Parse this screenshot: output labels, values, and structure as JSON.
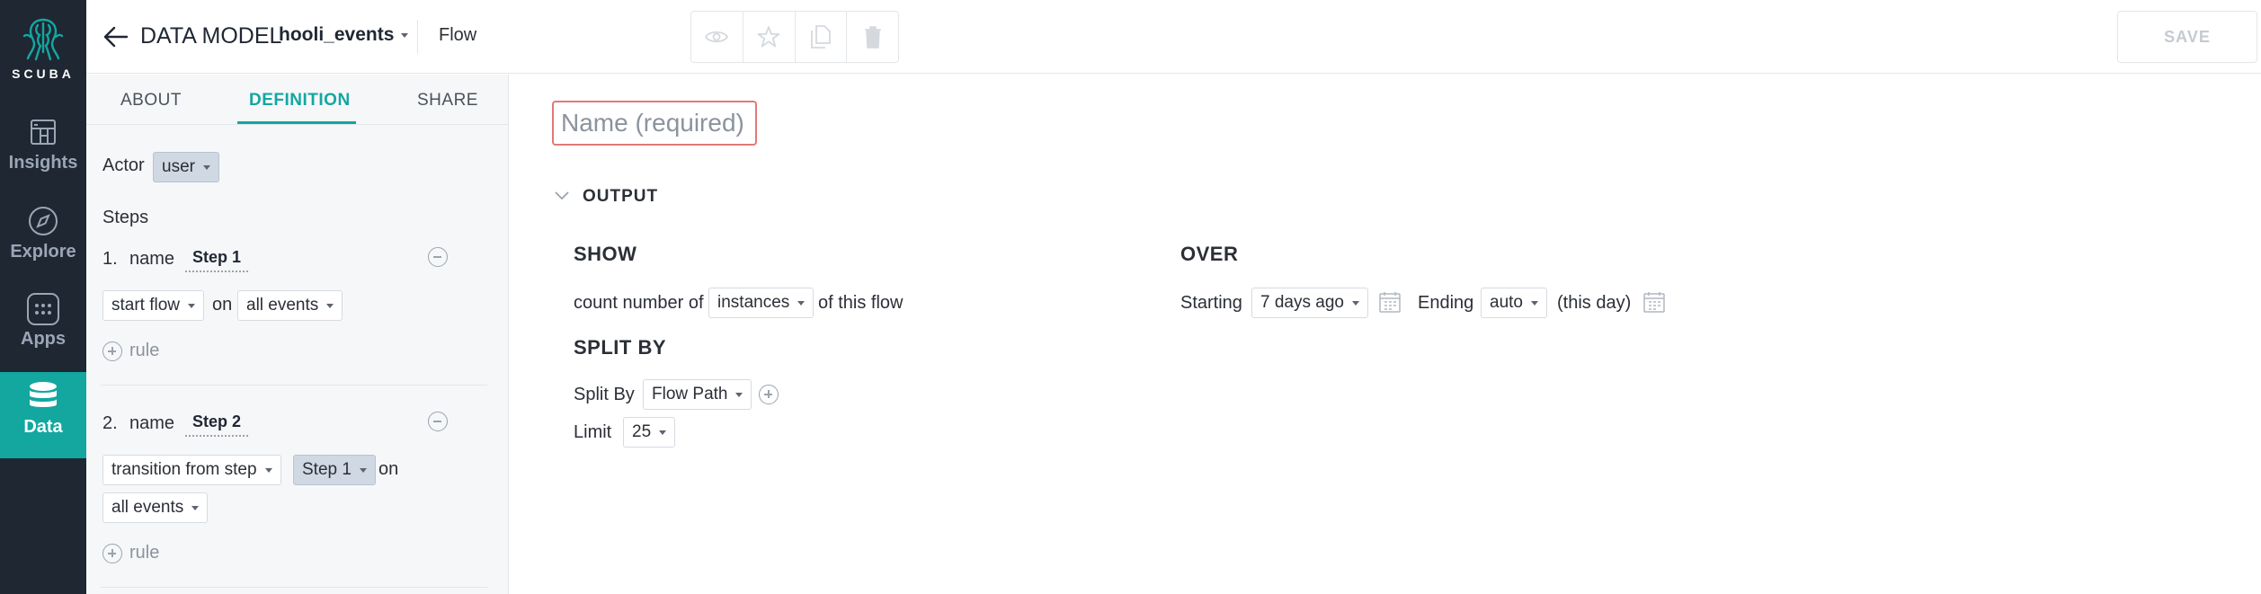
{
  "nav": {
    "logo_text": "SCUBA",
    "items": [
      {
        "label": "Insights",
        "icon": "insights-icon"
      },
      {
        "label": "Explore",
        "icon": "compass-icon"
      },
      {
        "label": "Apps",
        "icon": "apps-grid-icon"
      },
      {
        "label": "Data",
        "icon": "database-icon",
        "active": true
      }
    ]
  },
  "header": {
    "data_model_label": "DATA MODEL",
    "data_model_name": "hooli_events",
    "object_type": "Flow",
    "save_label": "SAVE"
  },
  "panel": {
    "tabs": [
      "ABOUT",
      "DEFINITION",
      "SHARE"
    ],
    "active_tab": "DEFINITION",
    "actor_label": "Actor",
    "actor_value": "user",
    "steps_label": "Steps",
    "steps": [
      {
        "number": "1.",
        "name_label": "name",
        "name": "Step 1",
        "condition": "start flow",
        "on_label": "on",
        "events": "all events",
        "rule_label": "rule"
      },
      {
        "number": "2.",
        "name_label": "name",
        "name": "Step 2",
        "condition": "transition from step",
        "from_step": "Step 1",
        "on_label": "on",
        "events": "all events",
        "rule_label": "rule"
      }
    ]
  },
  "main": {
    "name_placeholder": "Name (required)",
    "output_label": "OUTPUT",
    "show": {
      "title": "SHOW",
      "prefix": "count number of",
      "value": "instances",
      "suffix": "of this flow"
    },
    "over": {
      "title": "OVER",
      "starting_label": "Starting",
      "starting_value": "7 days ago",
      "ending_label": "Ending",
      "ending_value": "auto",
      "ending_note": "(this day)"
    },
    "split_by": {
      "title": "SPLIT BY",
      "label": "Split By",
      "value": "Flow Path",
      "limit_label": "Limit",
      "limit_value": "25"
    }
  },
  "colors": {
    "nav_bg": "#1f2733",
    "accent": "#13a7a0",
    "error_border": "#e07a77"
  }
}
